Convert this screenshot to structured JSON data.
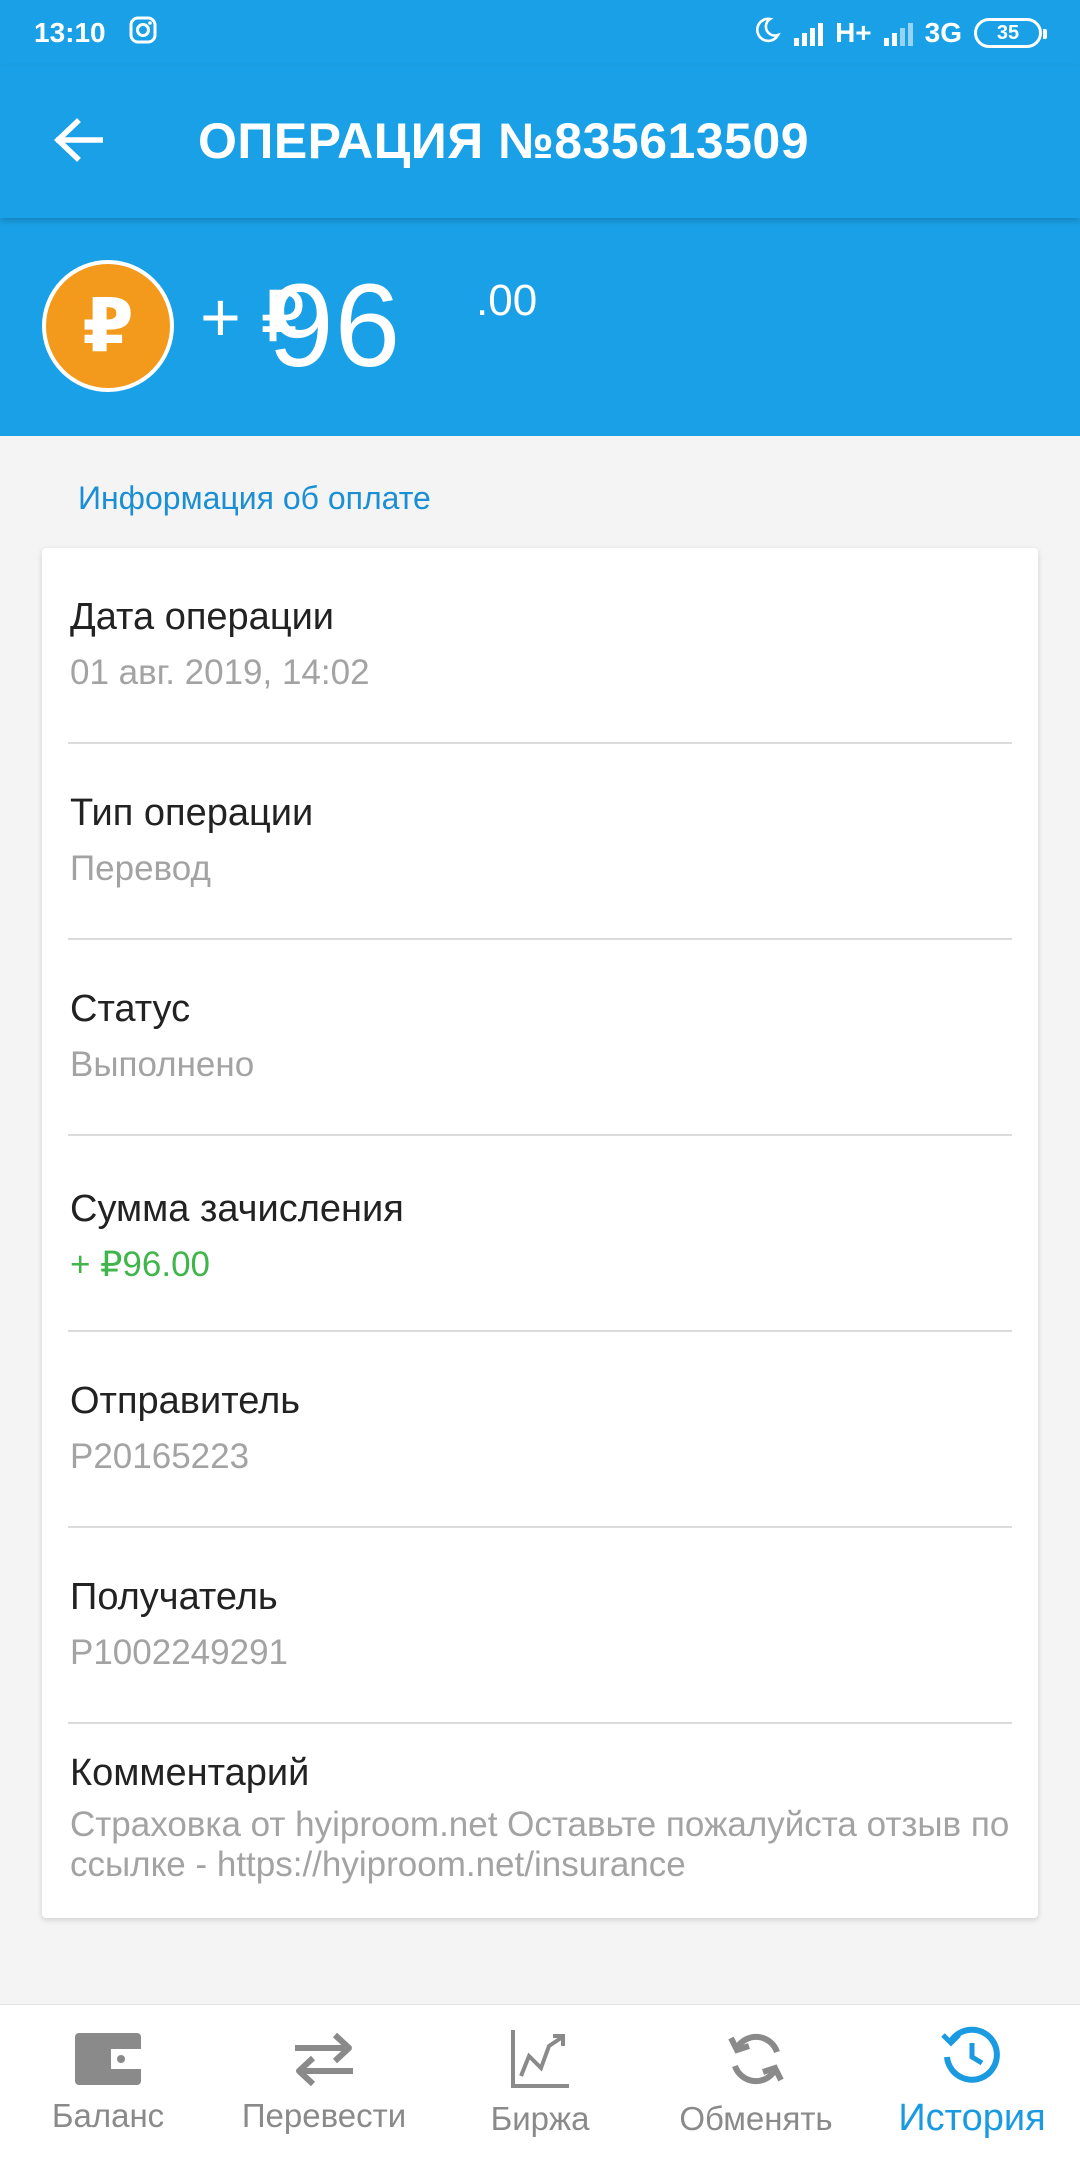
{
  "status_bar": {
    "time": "13:10",
    "network_1": "H+",
    "network_2": "3G",
    "battery": "35"
  },
  "app_bar": {
    "title": "ОПЕРАЦИЯ №835613509"
  },
  "amount": {
    "sign": "+ ₽",
    "main": "96",
    "cents": ".00",
    "coin_symbol": "₽"
  },
  "section_label": "Информация об оплате",
  "details": [
    {
      "label": "Дата операции",
      "value": "01 авг. 2019, 14:02"
    },
    {
      "label": "Тип операции",
      "value": "Перевод"
    },
    {
      "label": "Статус",
      "value": "Выполнено"
    },
    {
      "label": "Сумма зачисления",
      "value": "+ ₽96.00"
    },
    {
      "label": "Отправитель",
      "value": "P20165223"
    },
    {
      "label": "Получатель",
      "value": "P1002249291"
    },
    {
      "label": "Комментарий",
      "value": "Страховка от hyiproom.net  Оставьте пожалуйста отзыв по ссылке - https://hyiproom.net/insurance"
    }
  ],
  "bottom_nav": [
    {
      "label": "Баланс",
      "icon": "wallet-icon"
    },
    {
      "label": "Перевести",
      "icon": "transfer-icon"
    },
    {
      "label": "Биржа",
      "icon": "chart-icon"
    },
    {
      "label": "Обменять",
      "icon": "exchange-icon"
    },
    {
      "label": "История",
      "icon": "history-icon",
      "active": true
    }
  ],
  "colors": {
    "primary": "#1aa0e6",
    "coin": "#f39a1c",
    "positive": "#3fb54b",
    "nav_active": "#1a9ae0"
  }
}
